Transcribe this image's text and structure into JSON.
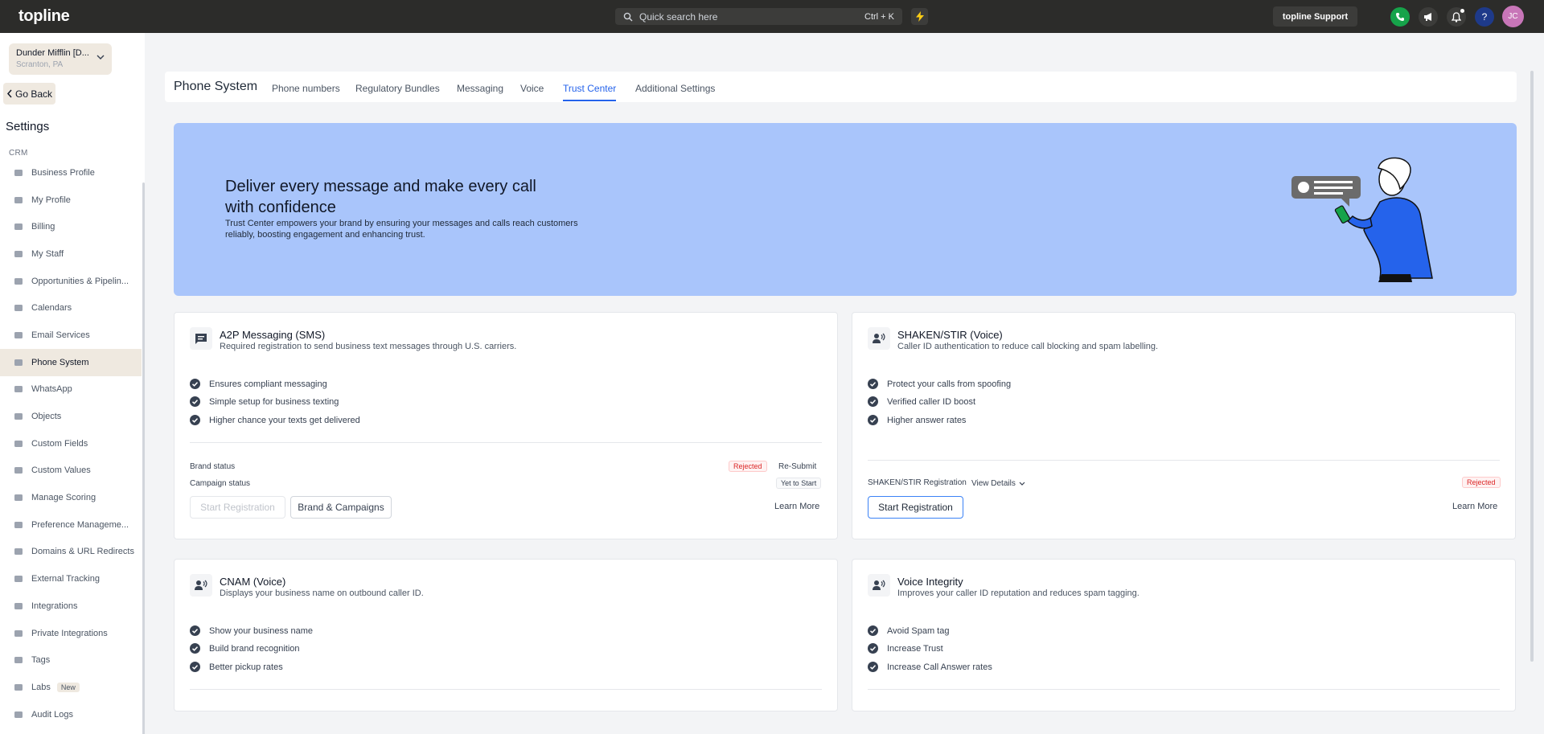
{
  "topbar": {
    "logo": "topline",
    "search_placeholder": "Quick search here",
    "search_shortcut": "Ctrl + K",
    "support_label": "topline Support",
    "avatar_initials": "JC",
    "colors": {
      "bg": "#2c2c2a",
      "phone": "#16a34a",
      "avatar": "#c876b8",
      "help": "#1e3a8a"
    }
  },
  "sidebar": {
    "account_name": "Dunder Mifflin [D...",
    "account_location": "Scranton, PA",
    "go_back": "Go Back",
    "title": "Settings",
    "section": "CRM",
    "items": [
      {
        "label": "Business Profile",
        "icon": "briefcase-icon"
      },
      {
        "label": "My Profile",
        "icon": "user-icon"
      },
      {
        "label": "Billing",
        "icon": "grid-icon"
      },
      {
        "label": "My Staff",
        "icon": "inbox-icon"
      },
      {
        "label": "Opportunities & Pipelin...",
        "icon": "target-icon"
      },
      {
        "label": "Calendars",
        "icon": "calendar-icon"
      },
      {
        "label": "Email Services",
        "icon": "email-icon"
      },
      {
        "label": "Phone System",
        "icon": "phone-icon",
        "active": true
      },
      {
        "label": "WhatsApp",
        "icon": "whatsapp-icon"
      },
      {
        "label": "Objects",
        "icon": "cubes-icon"
      },
      {
        "label": "Custom Fields",
        "icon": "edit-icon"
      },
      {
        "label": "Custom Values",
        "icon": "pie-icon"
      },
      {
        "label": "Manage Scoring",
        "icon": "chart-icon"
      },
      {
        "label": "Preference Manageme...",
        "icon": "sliders-icon"
      },
      {
        "label": "Domains & URL Redirects",
        "icon": "globe-icon"
      },
      {
        "label": "External Tracking",
        "icon": "star-icon"
      },
      {
        "label": "Integrations",
        "icon": "flow-icon"
      },
      {
        "label": "Private Integrations",
        "icon": "filter-icon"
      },
      {
        "label": "Tags",
        "icon": "tag-icon"
      },
      {
        "label": "Labs",
        "icon": "flask-icon",
        "badge": "New"
      },
      {
        "label": "Audit Logs",
        "icon": "bars-icon"
      }
    ]
  },
  "header": {
    "title": "Phone System",
    "tabs": [
      "Phone numbers",
      "Regulatory Bundles",
      "Messaging",
      "Voice",
      "Trust Center",
      "Additional Settings"
    ],
    "active_tab": "Trust Center"
  },
  "hero": {
    "title": "Deliver every message and make every call with confidence",
    "description": "Trust Center empowers your brand by ensuring your messages and calls reach customers reliably, boosting engagement and enhancing trust.",
    "bg_color": "#a9c5fb"
  },
  "cards": {
    "a2p": {
      "title": "A2P Messaging (SMS)",
      "subtitle": "Required registration to send business text messages through U.S. carriers.",
      "features": [
        "Ensures compliant messaging",
        "Simple setup for business texting",
        "Higher chance your texts get delivered"
      ],
      "brand_status_label": "Brand status",
      "brand_status": "Rejected",
      "resubmit": "Re-Submit",
      "campaign_status_label": "Campaign status",
      "campaign_status": "Yet to Start",
      "start_btn": "Start Registration",
      "brand_btn": "Brand & Campaigns",
      "learn_more": "Learn More"
    },
    "shaken": {
      "title": "SHAKEN/STIR (Voice)",
      "subtitle": "Caller ID authentication to reduce call blocking and spam labelling.",
      "features": [
        "Protect your calls from spoofing",
        "Verified caller ID boost",
        "Higher answer rates"
      ],
      "reg_label": "SHAKEN/STIR Registration",
      "view_details": "View Details",
      "status": "Rejected",
      "start_btn": "Start Registration",
      "learn_more": "Learn More"
    },
    "cnam": {
      "title": "CNAM (Voice)",
      "subtitle": "Displays your business name on outbound caller ID.",
      "features": [
        "Show your business name",
        "Build brand recognition",
        "Better pickup rates"
      ]
    },
    "voice_integrity": {
      "title": "Voice Integrity",
      "subtitle": "Improves your caller ID reputation and reduces spam tagging.",
      "features": [
        "Avoid Spam tag",
        "Increase Trust",
        "Increase Call Answer rates"
      ]
    }
  }
}
